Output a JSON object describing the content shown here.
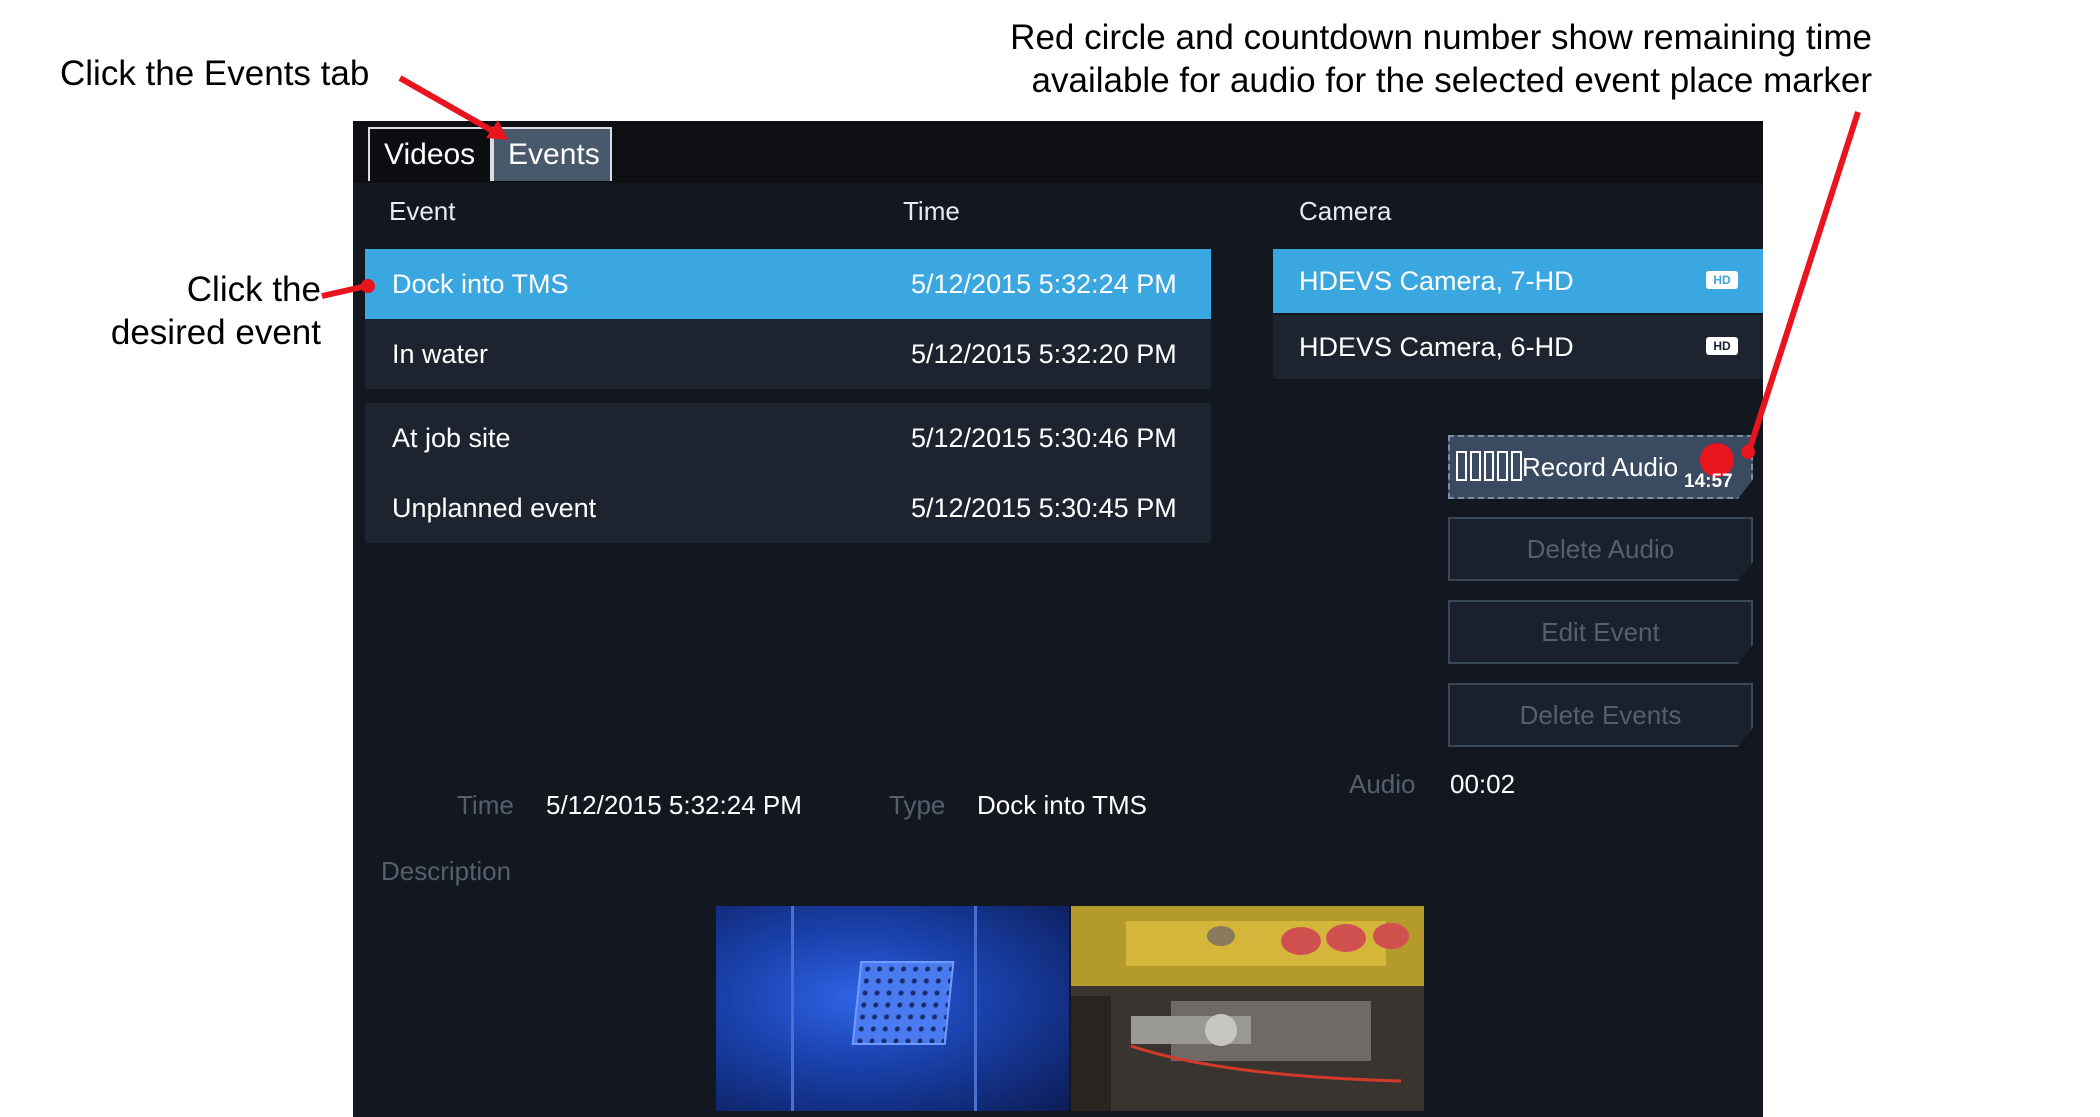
{
  "annotations": {
    "events_tab": "Click the Events tab",
    "select_event": [
      "Click the",
      "desired event"
    ],
    "record_note": [
      "Red circle and countdown number show remaining time",
      "available for audio for the selected event place marker"
    ]
  },
  "tabs": [
    {
      "label": "Videos",
      "active": false
    },
    {
      "label": "Events",
      "active": true
    }
  ],
  "events_table": {
    "headers": {
      "event": "Event",
      "time": "Time"
    },
    "rows": [
      {
        "event": "Dock into TMS",
        "time": "5/12/2015 5:32:24 PM",
        "selected": true
      },
      {
        "event": "In water",
        "time": "5/12/2015 5:32:20 PM",
        "selected": false
      },
      {
        "event": "At job site",
        "time": "5/12/2015 5:30:46 PM",
        "selected": false
      },
      {
        "event": "Unplanned event",
        "time": "5/12/2015 5:30:45 PM",
        "selected": false
      }
    ]
  },
  "camera_list": {
    "header": "Camera",
    "items": [
      {
        "name": "HDEVS Camera, 7-HD",
        "badge": "HD",
        "selected": true
      },
      {
        "name": "HDEVS Camera, 6-HD",
        "badge": "HD",
        "selected": false
      }
    ]
  },
  "actions": {
    "record_audio": "Record Audio",
    "record_timer": "14:57",
    "delete_audio": "Delete Audio",
    "edit_event": "Edit Event",
    "delete_events": "Delete Events"
  },
  "details": {
    "time_label": "Time",
    "time_value": "5/12/2015 5:32:24 PM",
    "type_label": "Type",
    "type_value": "Dock into TMS",
    "audio_label": "Audio",
    "audio_value": "00:02",
    "description_label": "Description"
  },
  "colors": {
    "background": "#131720",
    "selected_row": "#3aa7e0",
    "row": "#1d2430",
    "annotation_arrow": "#e8141e",
    "disabled_text": "#54606d"
  }
}
